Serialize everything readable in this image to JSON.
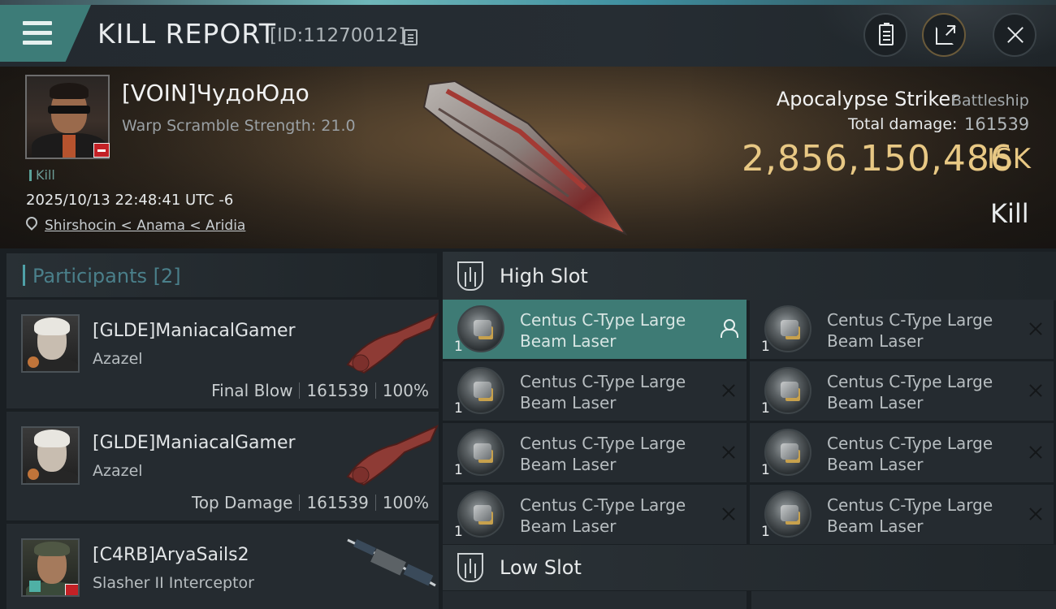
{
  "header": {
    "title": "KILL REPORT",
    "report_id": "[ID:11270012]",
    "buttons": [
      "clipboard-icon",
      "export-icon",
      "close-icon"
    ]
  },
  "victim": {
    "name": "[VOIN]ЧудоЮдо",
    "warp_scramble": "Warp Scramble Strength: 21.0",
    "tag": "Kill",
    "datetime": "2025/10/13 22:48:41 UTC -6",
    "location": "Shirshocin < Anama < Aridia",
    "ship_name": "Apocalypse Striker",
    "ship_class": "Battleship",
    "total_damage_label": "Total damage:",
    "total_damage": "161539",
    "isk_value": "2,856,150,486",
    "isk_unit": "ISK",
    "outcome": "Kill"
  },
  "participants": {
    "title": "Participants",
    "count": "[2]",
    "rows": [
      {
        "name": "[GLDE]ManiacalGamer",
        "ship": "Azazel",
        "role": "Final Blow",
        "damage": "161539",
        "percent": "100%"
      },
      {
        "name": "[GLDE]ManiacalGamer",
        "ship": "Azazel",
        "role": "Top Damage",
        "damage": "161539",
        "percent": "100%"
      },
      {
        "name": "[C4RB]AryaSails2",
        "ship": "Slasher II Interceptor"
      }
    ]
  },
  "slots": {
    "high_label": "High Slot",
    "low_label": "Low Slot",
    "high": [
      {
        "qty": "1",
        "name": "Centus C-Type Large Beam Laser"
      },
      {
        "qty": "1",
        "name": "Centus C-Type Large Beam Laser"
      },
      {
        "qty": "1",
        "name": "Centus C-Type Large Beam Laser"
      },
      {
        "qty": "1",
        "name": "Centus C-Type Large Beam Laser"
      },
      {
        "qty": "1",
        "name": "Centus C-Type Large Beam Laser"
      },
      {
        "qty": "1",
        "name": "Centus C-Type Large Beam Laser"
      },
      {
        "qty": "1",
        "name": "Centus C-Type Large Beam Laser"
      },
      {
        "qty": "1",
        "name": "Centus C-Type Large Beam Laser"
      }
    ]
  }
}
